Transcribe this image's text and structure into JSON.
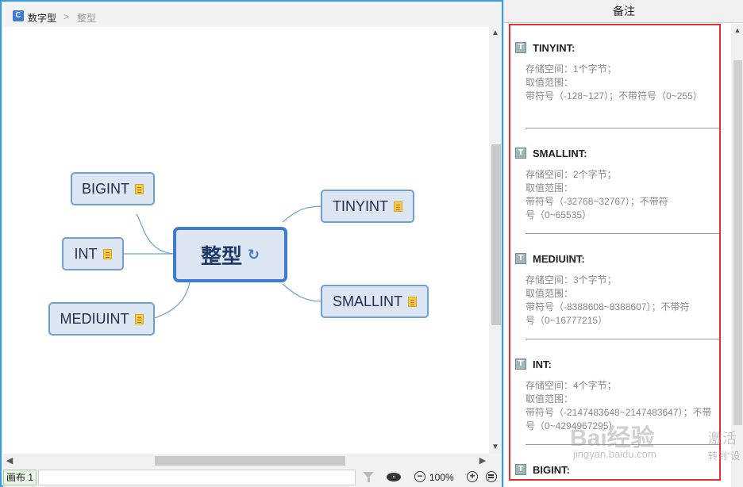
{
  "breadcrumb": {
    "icon_letter": "C",
    "root": "数字型",
    "separator": ">",
    "current": "整型"
  },
  "mindmap": {
    "central": "整型",
    "central_icon": "↻",
    "right_nodes": [
      "TINYINT",
      "SMALLINT"
    ],
    "left_nodes": [
      "BIGINT",
      "INT",
      "MEDIUINT"
    ],
    "line_color": "#6f9fd6",
    "node_fill": "#dce6f3"
  },
  "statusbar": {
    "sheet_tab": "画布 1",
    "zoom_out": "−",
    "zoom_value": "100%",
    "zoom_in": "+"
  },
  "notes": {
    "title": "备注",
    "sections": [
      {
        "heading": "TINYINT:",
        "lines": [
          "存储空间：1个字节；",
          "取值范围：",
          "带符号（-128~127）；不带符号（0~255）"
        ]
      },
      {
        "heading": "SMALLINT:",
        "lines": [
          "存储空间：2个字节；",
          "取值范围：",
          "带符号（-32768~32767）；不带符",
          "号（0~65535）"
        ]
      },
      {
        "heading": "MEDIUINT:",
        "lines": [
          "存储空间：3个字节；",
          "取值范围：",
          "带符号（-8388608~8388607）；不带符",
          "号（0~16777215）"
        ]
      },
      {
        "heading": "INT:",
        "lines": [
          "存储空间：4个字节；",
          "取值范围：",
          "带符号（-2147483648~2147483647）；不带",
          "号（0~4294967295）"
        ]
      },
      {
        "heading": "BIGINT:",
        "lines": []
      }
    ]
  },
  "watermark": {
    "logo": "Bai经验",
    "url": "jingyan.baidu.com",
    "side1": "激活",
    "side2": "转到\"设"
  },
  "accent_colors": {
    "frame_blue": "#3c9be0",
    "highlight_red": "#e03030"
  }
}
